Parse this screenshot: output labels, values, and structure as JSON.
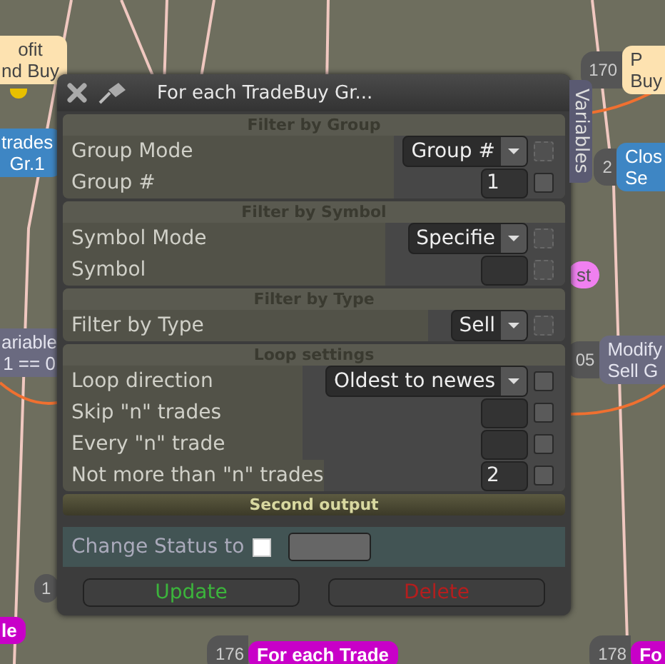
{
  "canvas": {
    "nodes": [
      {
        "kind": "cream",
        "lines": [
          "ofit",
          "nd Buy"
        ]
      },
      {
        "kind": "cream",
        "number": "170",
        "lines": [
          "P",
          "Buy"
        ]
      },
      {
        "kind": "blue",
        "lines": [
          "trades",
          "Gr.1"
        ]
      },
      {
        "kind": "blue",
        "number": "2",
        "lines": [
          "Clos",
          "Se"
        ]
      },
      {
        "kind": "pink",
        "lines": [
          "st"
        ]
      },
      {
        "kind": "grey",
        "lines": [
          "ariable",
          "1 == 0"
        ]
      },
      {
        "kind": "grey",
        "number": "05",
        "lines": [
          "Modify",
          "Sell G"
        ]
      },
      {
        "kind": "badge",
        "number": "1"
      },
      {
        "kind": "magenta",
        "lines": [
          "le"
        ]
      },
      {
        "kind": "magenta",
        "number": "176",
        "lines": [
          "For each Trade"
        ]
      },
      {
        "kind": "magenta",
        "number": "178",
        "lines": [
          "Fo"
        ]
      }
    ]
  },
  "window": {
    "title": "For each TradeBuy Gr...",
    "side_tab": "Variables"
  },
  "sections": [
    {
      "title": "Filter by Group",
      "rows": [
        {
          "label": "Group Mode",
          "kind": "dropdown",
          "value": "Group #",
          "disabled": true
        },
        {
          "label": "Group #",
          "kind": "number",
          "value": "1",
          "disabled": false
        }
      ]
    },
    {
      "title": "Filter by Symbol",
      "rows": [
        {
          "label": "Symbol Mode",
          "kind": "dropdown",
          "value": "Specifie",
          "disabled": true
        },
        {
          "label": "Symbol",
          "kind": "number",
          "value": "",
          "disabled": true
        }
      ]
    },
    {
      "title": "Filter by Type",
      "rows": [
        {
          "label": "Filter by Type",
          "kind": "dropdown",
          "value": "Sell",
          "disabled": true
        }
      ]
    },
    {
      "title": "Loop settings",
      "rows": [
        {
          "label": "Loop direction",
          "kind": "dropdown",
          "value": "Oldest to newes",
          "disabled": false
        },
        {
          "label": "Skip \"n\" trades",
          "kind": "number",
          "value": "",
          "disabled": false
        },
        {
          "label": "Every \"n\" trade",
          "kind": "number",
          "value": "",
          "disabled": false
        },
        {
          "label": "Not more than \"n\" trades",
          "kind": "number",
          "value": "2",
          "disabled": false
        }
      ]
    }
  ],
  "second_output": {
    "title": "Second output",
    "label": "Change Status to",
    "checked": false
  },
  "buttons": [
    {
      "label": "Update",
      "kind": "ok"
    },
    {
      "label": "Delete",
      "kind": "danger"
    }
  ]
}
